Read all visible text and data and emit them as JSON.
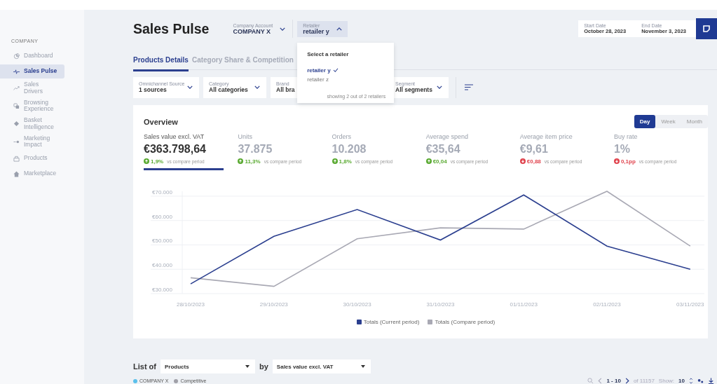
{
  "sidebar": {
    "section": "COMPANY",
    "items": [
      {
        "label": "Dashboard",
        "kind": "pie",
        "selected": false
      },
      {
        "label": "Sales Pulse",
        "kind": "pulse",
        "selected": true
      },
      {
        "label": "Sales Drivers",
        "kind": "trend",
        "selected": false
      },
      {
        "label": "Browsing Experience",
        "kind": "pages",
        "selected": false
      },
      {
        "label": "Basket Intelligence",
        "kind": "basket",
        "selected": false
      },
      {
        "label": "Marketing Impact",
        "kind": "target",
        "selected": false
      },
      {
        "label": "Products",
        "kind": "box",
        "selected": false
      },
      {
        "label": "Marketplace",
        "kind": "house",
        "selected": false
      }
    ]
  },
  "header": {
    "title": "Sales Pulse",
    "account": {
      "label": "Company Account",
      "value": "COMPANY X",
      "expanded": false
    },
    "retailer": {
      "label": "Retailer",
      "value": "retailer y",
      "expanded": true
    },
    "dates": [
      {
        "label": "Start Date",
        "value": "October 28, 2023"
      },
      {
        "label": "End Date",
        "value": "November 3, 2023"
      }
    ]
  },
  "retailer_menu": {
    "title": "Select a retailer",
    "options": [
      {
        "label": "retailer y",
        "selected": true
      },
      {
        "label": "retailer z",
        "selected": false
      }
    ],
    "footer": "showing 2 out of 2 retailers"
  },
  "tabs": [
    {
      "label": "Products Details",
      "selected": true
    },
    {
      "label": "Category Share & Competition",
      "selected": false
    }
  ],
  "filters": [
    {
      "label": "Omnichannel Source",
      "value": "1 sources"
    },
    {
      "label": "Category",
      "value": "All categories"
    },
    {
      "label": "Brand",
      "value": "All bra"
    },
    {
      "label": "Segment",
      "value": "All segments"
    }
  ],
  "overview": {
    "title": "Overview",
    "periods": [
      {
        "label": "Day",
        "selected": true
      },
      {
        "label": "Week",
        "selected": false
      },
      {
        "label": "Month",
        "selected": false
      }
    ],
    "kpis": [
      {
        "label": "Sales value excl. VAT",
        "value": "€363.798,64",
        "change": "1,9%",
        "positive": true,
        "note": "vs compare period",
        "selected": true
      },
      {
        "label": "Units",
        "value": "37.875",
        "change": "11,3%",
        "positive": true,
        "note": "vs compare period",
        "selected": false
      },
      {
        "label": "Orders",
        "value": "10.208",
        "change": "1,8%",
        "positive": true,
        "note": "vs compare period",
        "selected": false
      },
      {
        "label": "Average spend",
        "value": "€35,64",
        "change": "€0,04",
        "positive": true,
        "note": "vs compare period",
        "selected": false
      },
      {
        "label": "Average item price",
        "value": "€9,61",
        "change": "€0,88",
        "positive": false,
        "note": "vs compare period",
        "selected": false
      },
      {
        "label": "Buy rate",
        "value": "1%",
        "change": "0,1pp",
        "positive": false,
        "note": "vs compare period",
        "selected": false
      }
    ],
    "chart_data": {
      "type": "line",
      "categories": [
        "28/10/2023",
        "29/10/2023",
        "30/10/2023",
        "31/10/2023",
        "01/11/2023",
        "02/11/2023",
        "03/11/2023"
      ],
      "series": [
        {
          "name": "Totals (Current period)",
          "color": "#2b3f8f",
          "values": [
            34000,
            53500,
            64500,
            52000,
            70500,
            49500,
            40000
          ]
        },
        {
          "name": "Totals (Compare period)",
          "color": "#a9a9b4",
          "values": [
            36500,
            33000,
            52500,
            57000,
            56500,
            72000,
            49500
          ]
        }
      ],
      "ylim": [
        30000,
        72000
      ],
      "grid": true,
      "legend": true,
      "yticks": [
        {
          "value": 30000,
          "label": "€30.000"
        },
        {
          "value": 40000,
          "label": "€40.000"
        },
        {
          "value": 50000,
          "label": "€50.000"
        },
        {
          "value": 60000,
          "label": "€60.000"
        },
        {
          "value": 70000,
          "label": "€70.000"
        }
      ]
    }
  },
  "list": {
    "label": "List of",
    "entity": "Products",
    "by": "by",
    "metric": "Sales value excl. VAT"
  },
  "legend": [
    {
      "label": "COMPANY X",
      "color": "#5bc0eb"
    },
    {
      "label": "Competitive",
      "color": "#a0a0a8"
    }
  ],
  "pagination": {
    "range": "1 - 10",
    "total": "of 11157",
    "show_label": "Show:",
    "show_value": "10"
  }
}
